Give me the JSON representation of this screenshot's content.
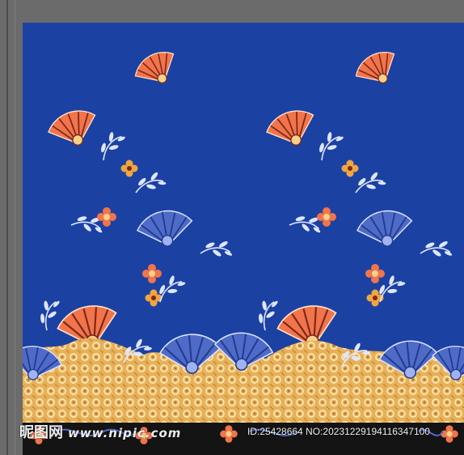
{
  "watermark": {
    "site_name": "昵图网",
    "site_url": "www.nipic.com",
    "id_text": "ID:25428664 NO:20231229194116347100"
  },
  "colors": {
    "background_blue": "#1b42a2",
    "border_band": "#e7b159",
    "coral": "#f2744b",
    "fan_blue": "#4f6bc8",
    "frame_gray": "#6b6b6b"
  },
  "icons": [
    "fan-motif-icon",
    "flower-motif-icon",
    "leaf-spray-icon"
  ]
}
